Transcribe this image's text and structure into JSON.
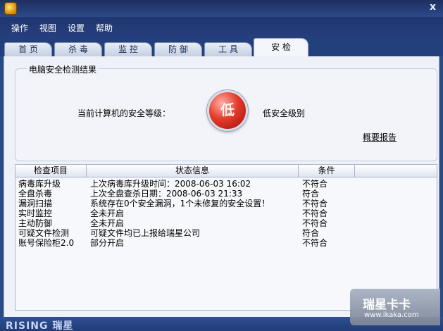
{
  "window": {
    "close_glyph": "x"
  },
  "menu": [
    "操作",
    "视图",
    "设置",
    "帮助"
  ],
  "tabs": [
    {
      "label": "首 页",
      "active": false
    },
    {
      "label": "杀 毒",
      "active": false
    },
    {
      "label": "监 控",
      "active": false
    },
    {
      "label": "防 御",
      "active": false
    },
    {
      "label": "工 具",
      "active": false
    },
    {
      "label": "安 检",
      "active": true
    }
  ],
  "result_panel": {
    "title": "电脑安全检测结果",
    "level_label": "当前计算机的安全等级：",
    "level_badge": "低",
    "level_value": "低安全级别",
    "summary_link": "概要报告"
  },
  "table": {
    "columns": [
      "检查项目",
      "状态信息",
      "条件"
    ],
    "rows": [
      [
        "病毒库升级",
        "上次病毒库升级时间：2008-06-03 16:02",
        "不符合"
      ],
      [
        "全盘杀毒",
        "上次全盘查杀日期：2008-06-03 21:33",
        "符合"
      ],
      [
        "漏洞扫描",
        "系统存在0个安全漏洞，1个未修复的安全设置！",
        "不符合"
      ],
      [
        "实时监控",
        "全未开启",
        "不符合"
      ],
      [
        "主动防御",
        "全未开启",
        "不符合"
      ],
      [
        "可疑文件检测",
        "可疑文件均已上报给瑞星公司",
        "符合"
      ],
      [
        "账号保险柜2.0",
        "部分开启",
        "不符合"
      ]
    ]
  },
  "footer": {
    "brand": "RISING 瑞星"
  },
  "watermark": {
    "main": "瑞星卡卡",
    "url": "www.ikaka.com"
  }
}
